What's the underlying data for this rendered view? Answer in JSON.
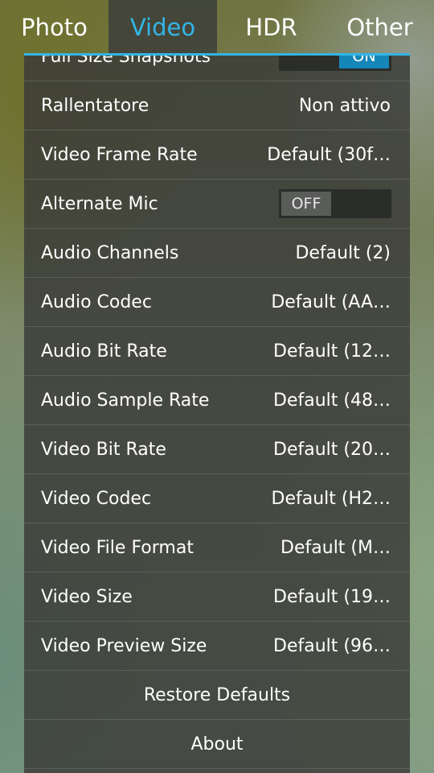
{
  "tabs": [
    {
      "label": "Photo",
      "selected": false
    },
    {
      "label": "Video",
      "selected": true
    },
    {
      "label": "HDR",
      "selected": false
    },
    {
      "label": "Other",
      "selected": false
    }
  ],
  "colors": {
    "accent": "#33b5e5",
    "toggle_on": "#1586b8",
    "panel": "#3a3c38"
  },
  "settings": [
    {
      "label": "Full Size Snapshots",
      "toggle": "ON"
    },
    {
      "label": "Rallentatore",
      "value": "Non attivo"
    },
    {
      "label": "Video Frame Rate",
      "value": "Default (30f…"
    },
    {
      "label": "Alternate Mic",
      "toggle": "OFF"
    },
    {
      "label": "Audio Channels",
      "value": "Default (2)"
    },
    {
      "label": "Audio Codec",
      "value": "Default (AA…"
    },
    {
      "label": "Audio Bit Rate",
      "value": "Default (12…"
    },
    {
      "label": "Audio Sample Rate",
      "value": "Default (48…"
    },
    {
      "label": "Video Bit Rate",
      "value": "Default (20…"
    },
    {
      "label": "Video Codec",
      "value": "Default (H2…"
    },
    {
      "label": "Video File Format",
      "value": "Default (M…"
    },
    {
      "label": "Video Size",
      "value": "Default (19…"
    },
    {
      "label": "Video Preview Size",
      "value": "Default (96…"
    }
  ],
  "actions": {
    "restore_defaults": "Restore Defaults",
    "about": "About"
  }
}
